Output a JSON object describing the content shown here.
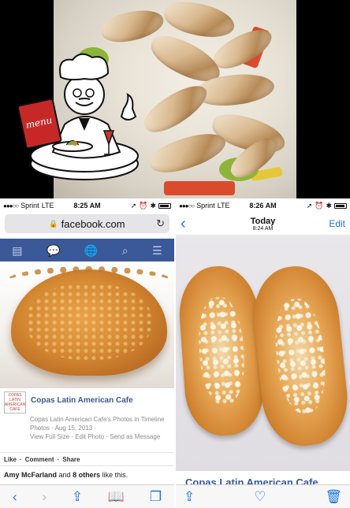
{
  "left_phone": {
    "status": {
      "carrier": "Sprint",
      "network": "LTE",
      "time": "8:25 AM"
    },
    "url": "facebook.com",
    "post": {
      "page_name": "Copas Latin American Cafe",
      "album": "Copas Latin American Cafe's Photos in Timeline",
      "meta": "Photos · Aug 15, 2013 ·",
      "links": "View Full Size · Edit Photo · Send as Message",
      "logo_text": "COPAS LATIN AMERICAN CAFE"
    },
    "actions": {
      "like": "Like",
      "comment": "Comment",
      "share": "Share",
      "sep": "·"
    },
    "likes": {
      "name": "Amy McFarland",
      "and": " and ",
      "others": "8 others",
      "suffix": " like this."
    }
  },
  "right_phone": {
    "status": {
      "carrier": "Sprint",
      "network": "LTE",
      "time": "8:26 AM"
    },
    "title": "Today",
    "subtitle": "8:24 AM",
    "edit": "Edit",
    "caption": "Copas Latin American Cafe"
  },
  "badge": {
    "menu_text": "menu"
  }
}
